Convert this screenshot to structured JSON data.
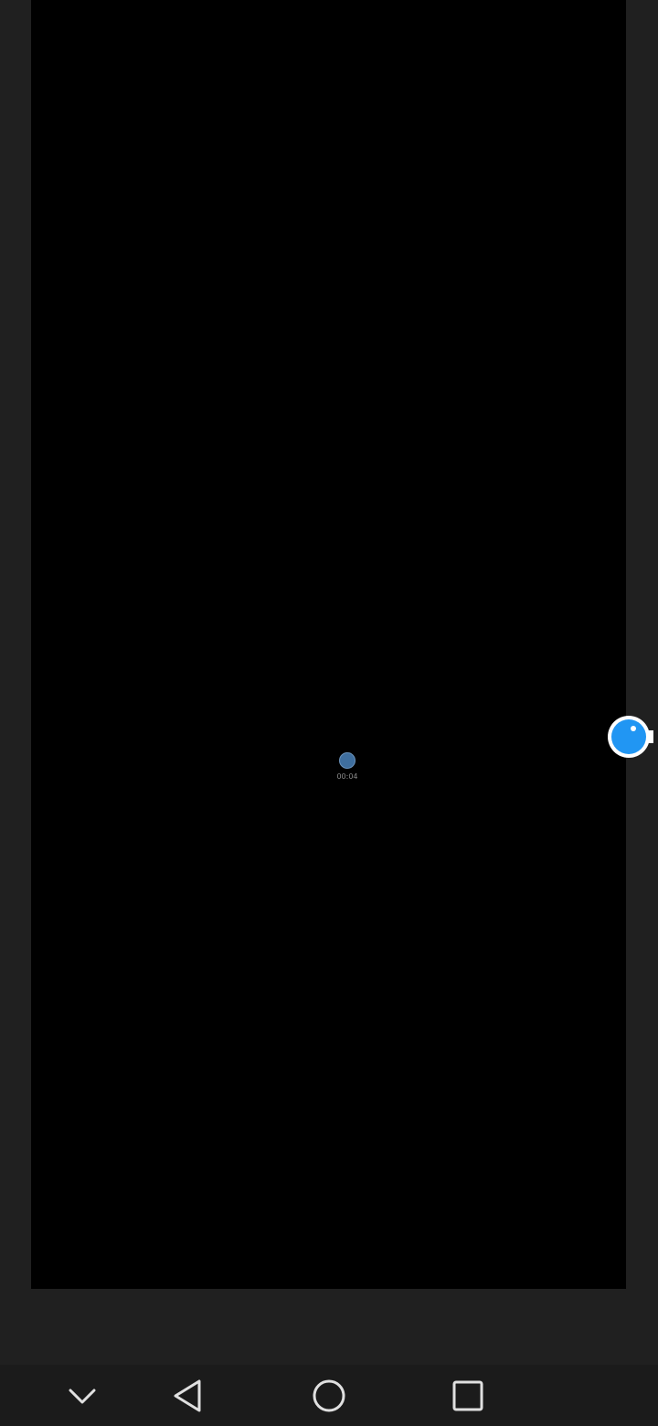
{
  "preview": {
    "timer": "00:04"
  },
  "icons": {
    "recording": "recording-dot-icon",
    "bubble": "floating-record-bubble-icon",
    "collapse": "chevron-down-icon",
    "back": "back-triangle-icon",
    "home": "home-circle-icon",
    "recents": "recents-square-icon"
  },
  "colors": {
    "background": "#202020",
    "preview": "#000000",
    "bubble": "#2196f3",
    "nav_bar": "#1b1b1b",
    "nav_icon": "#e0e0e0"
  }
}
